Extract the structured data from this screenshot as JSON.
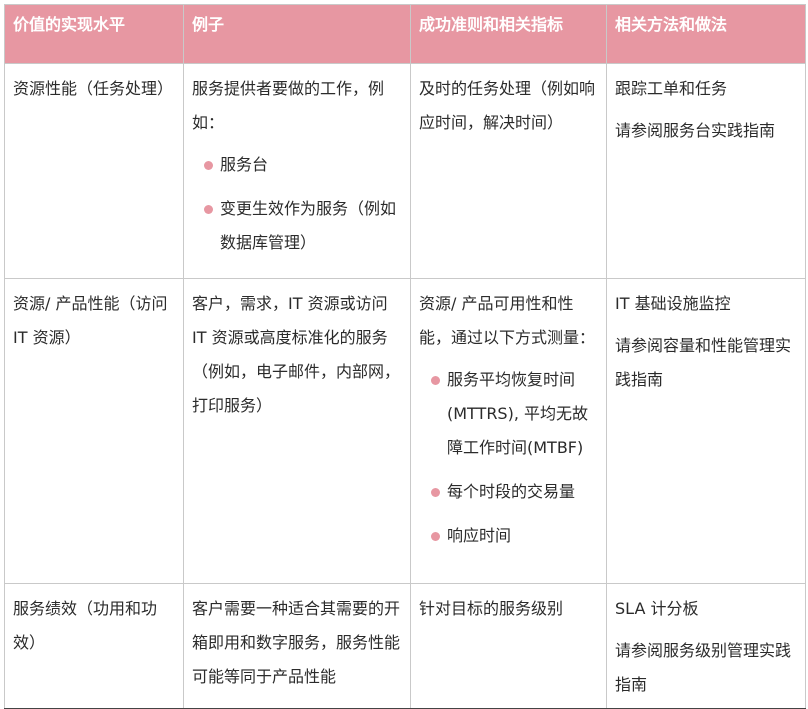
{
  "table": {
    "headers": [
      "价值的实现水平",
      "例子",
      "成功准则和相关指标",
      "相关方法和做法"
    ],
    "rows": [
      {
        "level": "资源性能（任务处理）",
        "example_text": "服务提供者要做的工作，例如：",
        "example_bullets": [
          "服务台",
          "变更生效作为服务（例如数据库管理）"
        ],
        "criteria_text": "及时的任务处理（例如响应时间，解决时间）",
        "criteria_bullets": [],
        "methods": [
          "跟踪工单和任务",
          "请参阅服务台实践指南"
        ]
      },
      {
        "level": "资源/ 产品性能（访问 IT 资源）",
        "example_text": "客户，需求，IT 资源或访问 IT 资源或高度标准化的服务（例如，电子邮件，内部网，打印服务）",
        "example_bullets": [],
        "criteria_text": "资源/ 产品可用性和性能，通过以下方式测量：",
        "criteria_bullets": [
          "服务平均恢复时间(MTTRS), 平均无故障工作时间(MTBF)",
          "每个时段的交易量",
          "响应时间"
        ],
        "methods": [
          "IT 基础设施监控",
          "请参阅容量和性能管理实践指南"
        ]
      },
      {
        "level": "服务绩效（功用和功效）",
        "example_text": "客户需要一种适合其需要的开箱即用和数字服务，服务性能可能等同于产品性能",
        "example_bullets": [],
        "criteria_text": "针对目标的服务级别",
        "criteria_bullets": [],
        "methods": [
          "SLA 计分板",
          "请参阅服务级别管理实践指南"
        ]
      }
    ]
  },
  "colors": {
    "header_bg": "#e797a2",
    "header_text": "#ffffff",
    "bullet": "#e797a2",
    "border": "#c9c9c9"
  }
}
